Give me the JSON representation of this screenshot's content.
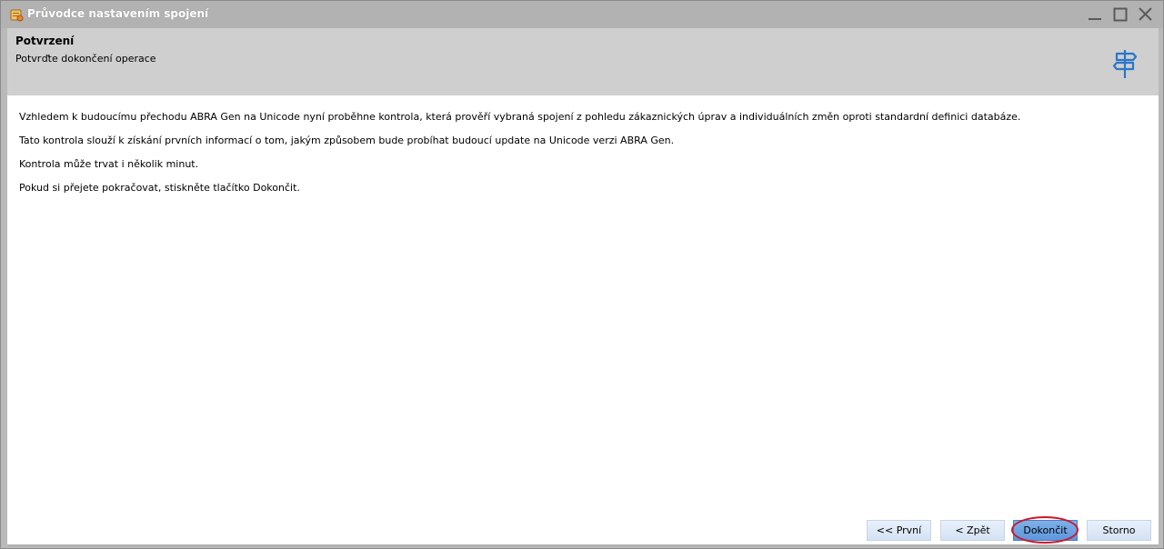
{
  "window": {
    "title": "Průvodce nastavením spojení",
    "icon": "wizard-app-icon",
    "controls": [
      "minimize-icon",
      "maximize-icon",
      "close-icon"
    ]
  },
  "header": {
    "title": "Potvrzení",
    "subtitle": "Potvrďte dokončení operace",
    "icon": "signpost-icon"
  },
  "content": {
    "paragraphs": [
      "Vzhledem k budoucímu přechodu ABRA Gen na Unicode nyní proběhne kontrola, která prověří vybraná spojení z pohledu zákaznických úprav a individuálních změn oproti standardní definici databáze.",
      "Tato kontrola slouží k získání prvních informací o tom, jakým způsobem bude probíhat budoucí update na Unicode verzi ABRA Gen.",
      "Kontrola může trvat i několik minut.",
      "Pokud si přejete pokračovat, stiskněte tlačítko Dokončit."
    ]
  },
  "buttons": {
    "first": "<< První",
    "back": "< Zpět",
    "finish": "Dokončit",
    "cancel": "Storno"
  },
  "colors": {
    "title_bar": "#b2b2b2",
    "header_bg": "#cfcfcf",
    "finish_button": "#5d97dc",
    "highlight": "#d0152a",
    "signpost": "#2b76c9"
  }
}
